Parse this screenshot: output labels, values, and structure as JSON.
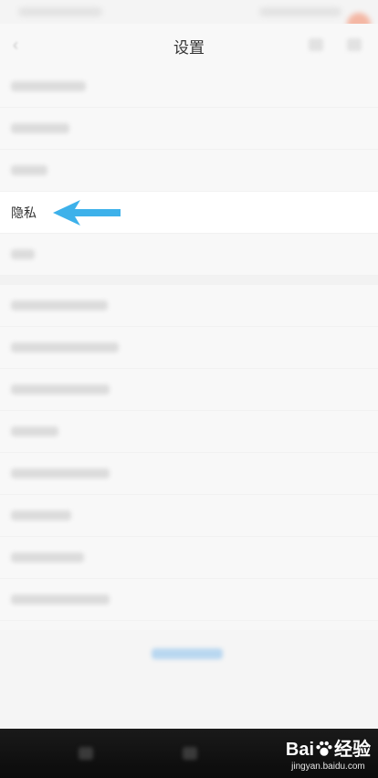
{
  "header": {
    "title": "设置",
    "back_icon": "chevron-left-icon"
  },
  "settings": {
    "privacy_label": "隐私"
  },
  "annotation": {
    "arrow_color": "#3db1ea",
    "arrow_icon": "arrow-left-icon"
  },
  "watermark": {
    "brand": "Bai",
    "brand_suffix": "经验",
    "url": "jingyan.baidu.com"
  }
}
